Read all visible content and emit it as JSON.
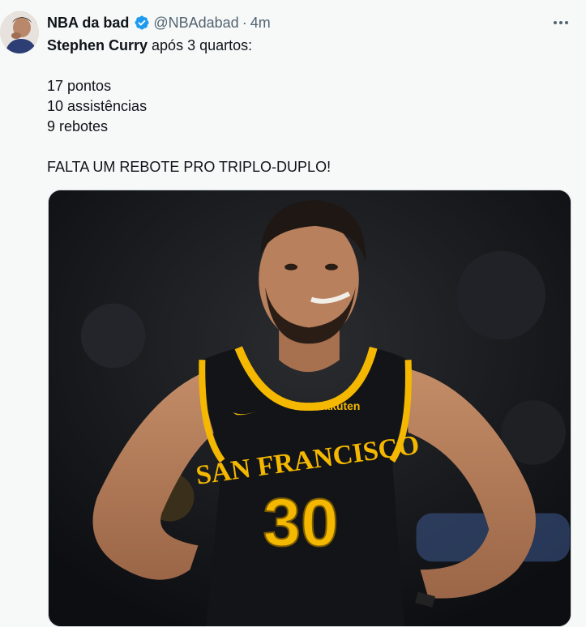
{
  "author": {
    "display_name": "NBA da bad",
    "handle": "@NBAdabad",
    "separator": "·",
    "time": "4m"
  },
  "tweet": {
    "line1_name": "Stephen Curry",
    "line1_rest": " após 3 quartos:",
    "stat1": "17 pontos",
    "stat2": "10 assistências",
    "stat3": "9 rebotes",
    "closing": "FALTA UM REBOTE PRO TRIPLO-DUPLO!"
  },
  "media": {
    "jersey_text": "SAN FRANCISCO",
    "jersey_number": "30",
    "sponsor": "Rakuten",
    "colors": {
      "jersey": "#111418",
      "trim": "#f5b800",
      "skin": "#b8805c"
    }
  },
  "icons": {
    "verified": "verified-badge-icon",
    "more": "more-options-icon"
  },
  "colors": {
    "verified": "#1d9bf0",
    "secondary_text": "#536471"
  }
}
